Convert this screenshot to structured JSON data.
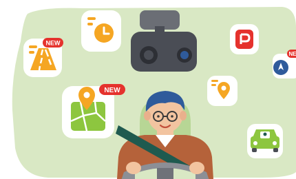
{
  "badges": {
    "road_badge": "NEW",
    "map_badge": "NEW",
    "compass_badge": "NE"
  },
  "colors": {
    "background_blob": "#d9e8c4",
    "orange_accent": "#f5a623",
    "red_badge": "#e5322d",
    "green_car": "#8dc63f",
    "camera_body": "#4a4d55",
    "seatbelt": "#1f5a4f",
    "jacket": "#b5623a",
    "hair": "#2f5b9b",
    "steering_wheel": "#8c8f96"
  },
  "icons": [
    "clock-icon",
    "road-icon",
    "dashcam-icon",
    "parking-icon",
    "location-pin-icon",
    "compass-icon",
    "map-icon",
    "car-driver-icon",
    "driver-illustration"
  ]
}
